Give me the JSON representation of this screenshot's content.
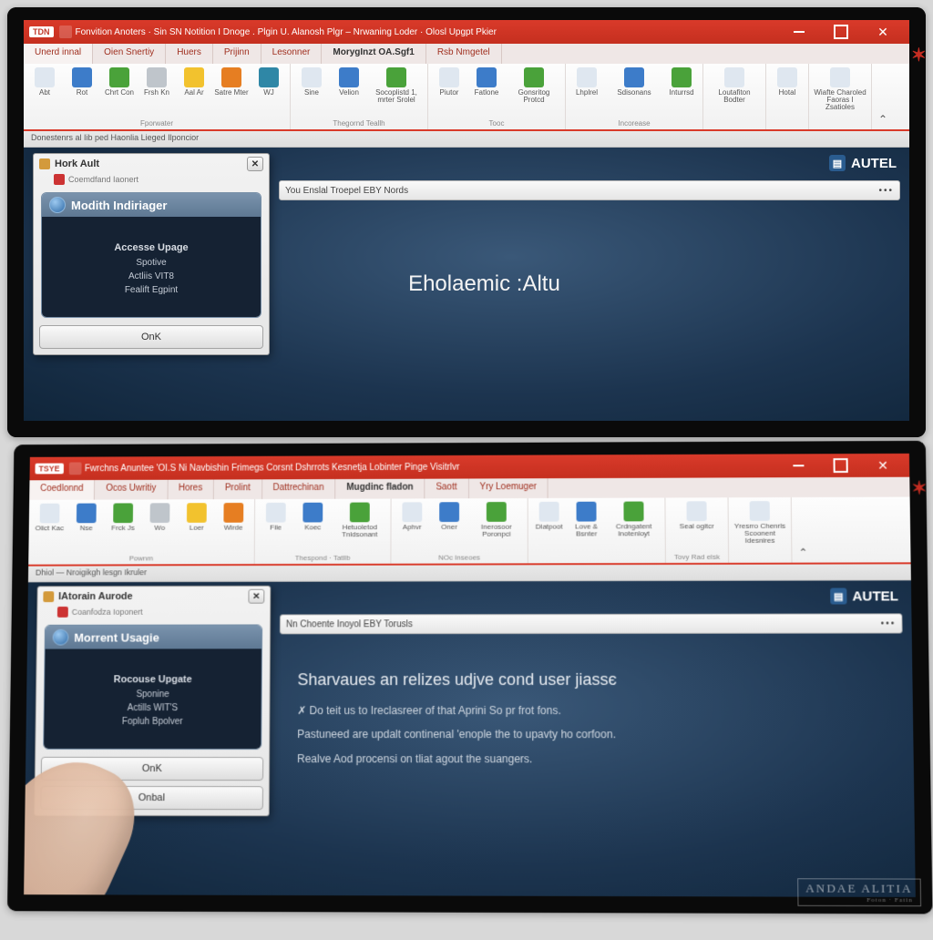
{
  "top": {
    "titlebar": {
      "badge": "TDN",
      "text": "Fonvition Anoters · Sin SN Notition I Dnoge . Plgin U. Alanosh Plgr – Nrwaning Loder · Olosl Upgpt Pkier"
    },
    "tabs": [
      "Unerd innal",
      "Oien Snertiy",
      "Huers",
      "Prijinn",
      "Lesonner",
      "MorygInzt OA.Sgf1",
      "Rsb Nmgetel"
    ],
    "ribbon_groups": [
      {
        "items": [
          {
            "l": "Abt"
          },
          {
            "l": "Rot"
          },
          {
            "l": "Chrt Con"
          },
          {
            "l": "Frsh Kn"
          },
          {
            "l": "Aal Ar"
          },
          {
            "l": "Satre Mter"
          },
          {
            "l": "WJ"
          }
        ],
        "label": "Fporwater"
      },
      {
        "items": [
          {
            "l": "Sine"
          },
          {
            "l": "Velion"
          },
          {
            "l": "Socoplistd 1, mrter Srolel",
            "wide": true
          }
        ],
        "label": "Thegornd Teallh"
      },
      {
        "items": [
          {
            "l": "Piutor"
          },
          {
            "l": "Fatlone"
          },
          {
            "l": "Gonsritog Protcd",
            "wide": true
          }
        ],
        "label": "Tooc"
      },
      {
        "items": [
          {
            "l": "Lhplrel"
          },
          {
            "l": "Sdisonans",
            "wide": true
          },
          {
            "l": "Inturrsd"
          }
        ],
        "label": "Incorease"
      },
      {
        "items": [
          {
            "l": "Loutafiton Bodter",
            "wide": true
          }
        ],
        "label": ""
      },
      {
        "items": [
          {
            "l": "Hotal"
          }
        ],
        "label": ""
      },
      {
        "items": [
          {
            "l": "Wiafte Charoled Faoras I Zsatioles",
            "wide": true
          }
        ],
        "label": ""
      }
    ],
    "docstrip": "Donestenrs al Iib ped Haonlia Lieged Ilponcior",
    "brand": "AUTEL",
    "screen_title": "You Enslal Troepel EBY Nords",
    "center_text": "Eholaemic :Altu",
    "dialog": {
      "title": "Hork Ault",
      "subtitle": "Coemdfand Iaonert",
      "panel_title": "Modith Indiriager",
      "body_h": "Accesse Upage",
      "body_l1": "Spotive",
      "body_l2": "Actliis VIT8",
      "body_l3": "Fealift Egpint",
      "ok": "OnK"
    }
  },
  "bot": {
    "titlebar": {
      "badge": "TSYE",
      "text": "Fwrchns Anuntee 'OI.S Ni Navbishin Frimegs   Corsnt Dshrrots    Kesnetja Lobinter   Pinge Visitrlvr"
    },
    "tabs": [
      "Coedlonnd",
      "Ocos Uwritiy",
      "Hores",
      "Prolint",
      "Dattrechinan",
      "Mugdinc fladon",
      "Saott",
      "Yry Loemuger"
    ],
    "ribbon_groups": [
      {
        "items": [
          {
            "l": "Olict Kac"
          },
          {
            "l": "Nse"
          },
          {
            "l": "Frck Js"
          },
          {
            "l": "Wo"
          },
          {
            "l": "Loer"
          },
          {
            "l": "Wirde"
          }
        ],
        "label": "Pownm"
      },
      {
        "items": [
          {
            "l": "File"
          },
          {
            "l": "Koec"
          },
          {
            "l": "Hetuoletod Tnldsonant",
            "wide": true
          }
        ],
        "label": "Thespond · Tatllb"
      },
      {
        "items": [
          {
            "l": "Aphvr"
          },
          {
            "l": "Oner"
          },
          {
            "l": "Inerosoor Poronpci",
            "wide": true
          }
        ],
        "label": "NOc Inseoes"
      },
      {
        "items": [
          {
            "l": "Dlatpoot"
          },
          {
            "l": "Love & Bsnter"
          },
          {
            "l": "Crdngatent Inotenloyt",
            "wide": true
          }
        ],
        "label": ""
      },
      {
        "items": [
          {
            "l": "Seal ogitcr",
            "wide": true
          }
        ],
        "label": "Tovy Rad elsk"
      },
      {
        "items": [
          {
            "l": "Yresrro Chenrls Scoonent Idesnires",
            "wide": true
          }
        ],
        "label": ""
      }
    ],
    "docstrip": "Dhiol — Nroigikgh lesgn Ikruler",
    "brand": "AUTEL",
    "screen_title": "Nn Choente Inoyol EBY Torusls",
    "dialog": {
      "title": "IAtorain Aurode",
      "subtitle": "Coanfodza Ioponert",
      "panel_title": "Morrent Usagie",
      "body_h": "Rocouse Upgate",
      "body_l1": "Sponine",
      "body_l2": "Actills WIT'S",
      "body_l3": "Fopluh Bpolver",
      "ok": "OnK",
      "ok2": "Onbal"
    },
    "message": {
      "heading": "Sharvaues an relizes udjve cond user jiassє",
      "p1_pre": "Do teit us to Ireclasreer of that Aprini So pr frot fons.",
      "p2": "Pastuneed are updalt continenal 'enople the to upavty ho corfoon.",
      "p3": "Realve Aod procensi on tliat agout the suangers."
    },
    "watermark": "ANDAE ALITIA",
    "watermark_sub": "Foton · Fatin"
  }
}
